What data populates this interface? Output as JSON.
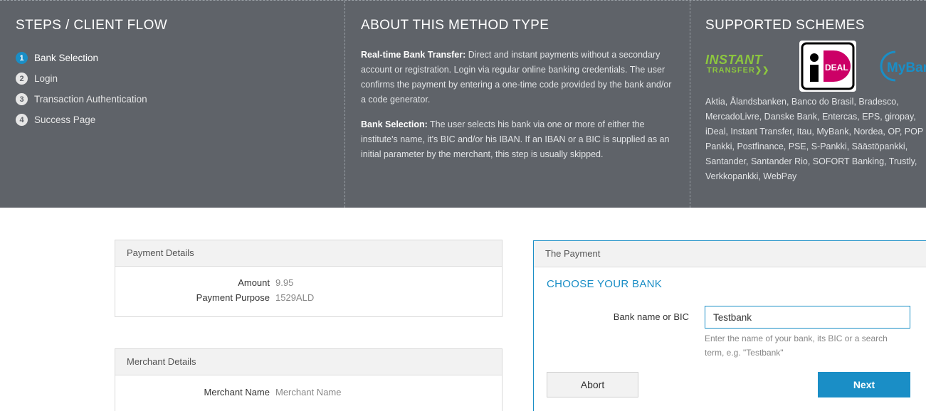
{
  "steps_column": {
    "title": "STEPS / CLIENT FLOW",
    "steps": [
      {
        "num": "1",
        "label": "Bank Selection"
      },
      {
        "num": "2",
        "label": "Login"
      },
      {
        "num": "3",
        "label": "Transaction Authentication"
      },
      {
        "num": "4",
        "label": "Success Page"
      }
    ],
    "active_step": "1"
  },
  "about_column": {
    "title": "ABOUT THIS METHOD TYPE",
    "para1_bold": "Real-time Bank Transfer:",
    "para1_text": " Direct and instant payments without a secondary account or registration. Login via regular online banking credentials. The user confirms the payment by entering a one-time code provided by the bank and/or a code generator.",
    "para2_bold": "Bank Selection:",
    "para2_text": " The user selects his bank via one or more of either the institute's name, it's BIC and/or his IBAN. If an IBAN or a BIC is supplied as an initial parameter by the merchant, this step is usually skipped."
  },
  "schemes_column": {
    "title": "SUPPORTED SCHEMES",
    "logos": {
      "instant_line1": "INSTANT",
      "instant_line2": "TRANSFER",
      "ideal": "iDEAL",
      "mybank": "MyBank"
    },
    "schemes_text": "Aktia, Ålandsbanken, Banco do Brasil, Bradesco, MercadoLivre, Danske Bank, Entercas, EPS, giropay, iDeal, Instant Transfer, Itau, MyBank, Nordea, OP, POP Pankki, Postfinance, PSE, S-Pankki, Säästöpankki, Santander, Santander Rio, SOFORT Banking, Trustly, Verkkopankki, WebPay"
  },
  "payment_details": {
    "heading": "Payment Details",
    "amount_label": "Amount",
    "amount_value": "9.95",
    "purpose_label": "Payment Purpose",
    "purpose_value": "1529ALD"
  },
  "merchant_details": {
    "heading": "Merchant Details",
    "name_label": "Merchant Name",
    "name_value": "Merchant Name"
  },
  "the_payment": {
    "heading": "The Payment",
    "title": "CHOOSE YOUR BANK",
    "bank_label": "Bank name or BIC",
    "bank_value": "Testbank",
    "help_text": "Enter the name of your bank, its BIC or a search term, e.g. \"Testbank\"",
    "abort_label": "Abort",
    "next_label": "Next"
  },
  "colors": {
    "band_bg": "#5f6369",
    "accent_blue": "#1a8ec6",
    "instant_green": "#8cc63f",
    "ideal_pink": "#cc0066"
  }
}
